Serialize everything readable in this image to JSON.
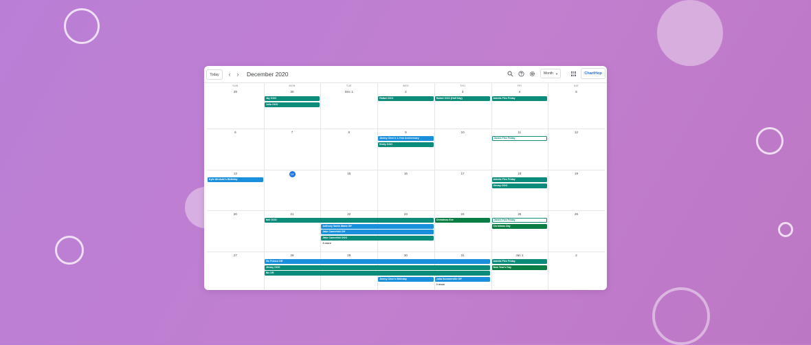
{
  "toolbar": {
    "today_label": "Today",
    "prev_label": "‹",
    "next_label": "›",
    "title": "December 2020",
    "view_label": "Month",
    "brand_label": "ChartHop"
  },
  "calendar": {
    "weekdays": [
      "SUN",
      "MON",
      "TUE",
      "WED",
      "THU",
      "FRI",
      "SAT"
    ],
    "weeks": [
      [
        "29",
        "30",
        "Dec 1",
        "2",
        "3",
        "4",
        "5"
      ],
      [
        "6",
        "7",
        "8",
        "9",
        "10",
        "11",
        "12"
      ],
      [
        "13",
        "14",
        "15",
        "16",
        "17",
        "18",
        "19"
      ],
      [
        "20",
        "21",
        "22",
        "23",
        "24",
        "25",
        "26"
      ],
      [
        "27",
        "28",
        "29",
        "30",
        "31",
        "Jan 1",
        "2"
      ]
    ],
    "today": "14",
    "events": [
      {
        "label": "Jay OOO",
        "style": "teal"
      },
      {
        "label": "Julio OOO",
        "style": "teal"
      },
      {
        "label": "Rafael OOO",
        "style": "teal"
      },
      {
        "label": "Rafael OOO (Half Day)",
        "style": "teal"
      },
      {
        "label": "Admits Flex Friday",
        "style": "teal"
      },
      {
        "label": "Jimmy Chen's 1-Year Anniversary",
        "style": "blue"
      },
      {
        "label": "Emily OOO",
        "style": "teal"
      },
      {
        "label": "Jana's Flex Friday",
        "style": "outline"
      },
      {
        "label": "Kyle Afrokule's Birthday",
        "style": "blue"
      },
      {
        "label": "Admits Flex Friday",
        "style": "teal"
      },
      {
        "label": "Jimmy OOO",
        "style": "teal"
      },
      {
        "label": "Neil OOO",
        "style": "teal"
      },
      {
        "label": "Anthony Santo Maria Off",
        "style": "blue"
      },
      {
        "label": "Jake Cannefeld Off",
        "style": "blue"
      },
      {
        "label": "Jake Cannefeld OOO",
        "style": "teal"
      },
      {
        "label": "Christmas Eve",
        "style": "green"
      },
      {
        "label": "Jana's Flex Friday",
        "style": "outline"
      },
      {
        "label": "Christmas Day",
        "style": "green"
      },
      {
        "label": "Vic Franco Off",
        "style": "blue"
      },
      {
        "label": "Jimmy OOO",
        "style": "teal"
      },
      {
        "label": "Nic DR",
        "style": "teal"
      },
      {
        "label": "Admits Flex Friday",
        "style": "teal"
      },
      {
        "label": "New Year's Day",
        "style": "green"
      },
      {
        "label": "Jimmy Chen's Birthday",
        "style": "blue"
      },
      {
        "label": "Julia Sommerville Off",
        "style": "blue"
      }
    ],
    "more": [
      "3 more",
      "2 more"
    ]
  },
  "colors": {
    "teal": "#0b8b7a",
    "blue": "#1a8fdc",
    "green": "#0a7d45",
    "today": "#1a73e8",
    "background": "#bd7fd3"
  },
  "icons": [
    "search-icon",
    "help-icon",
    "settings-icon",
    "apps-grid-icon"
  ]
}
